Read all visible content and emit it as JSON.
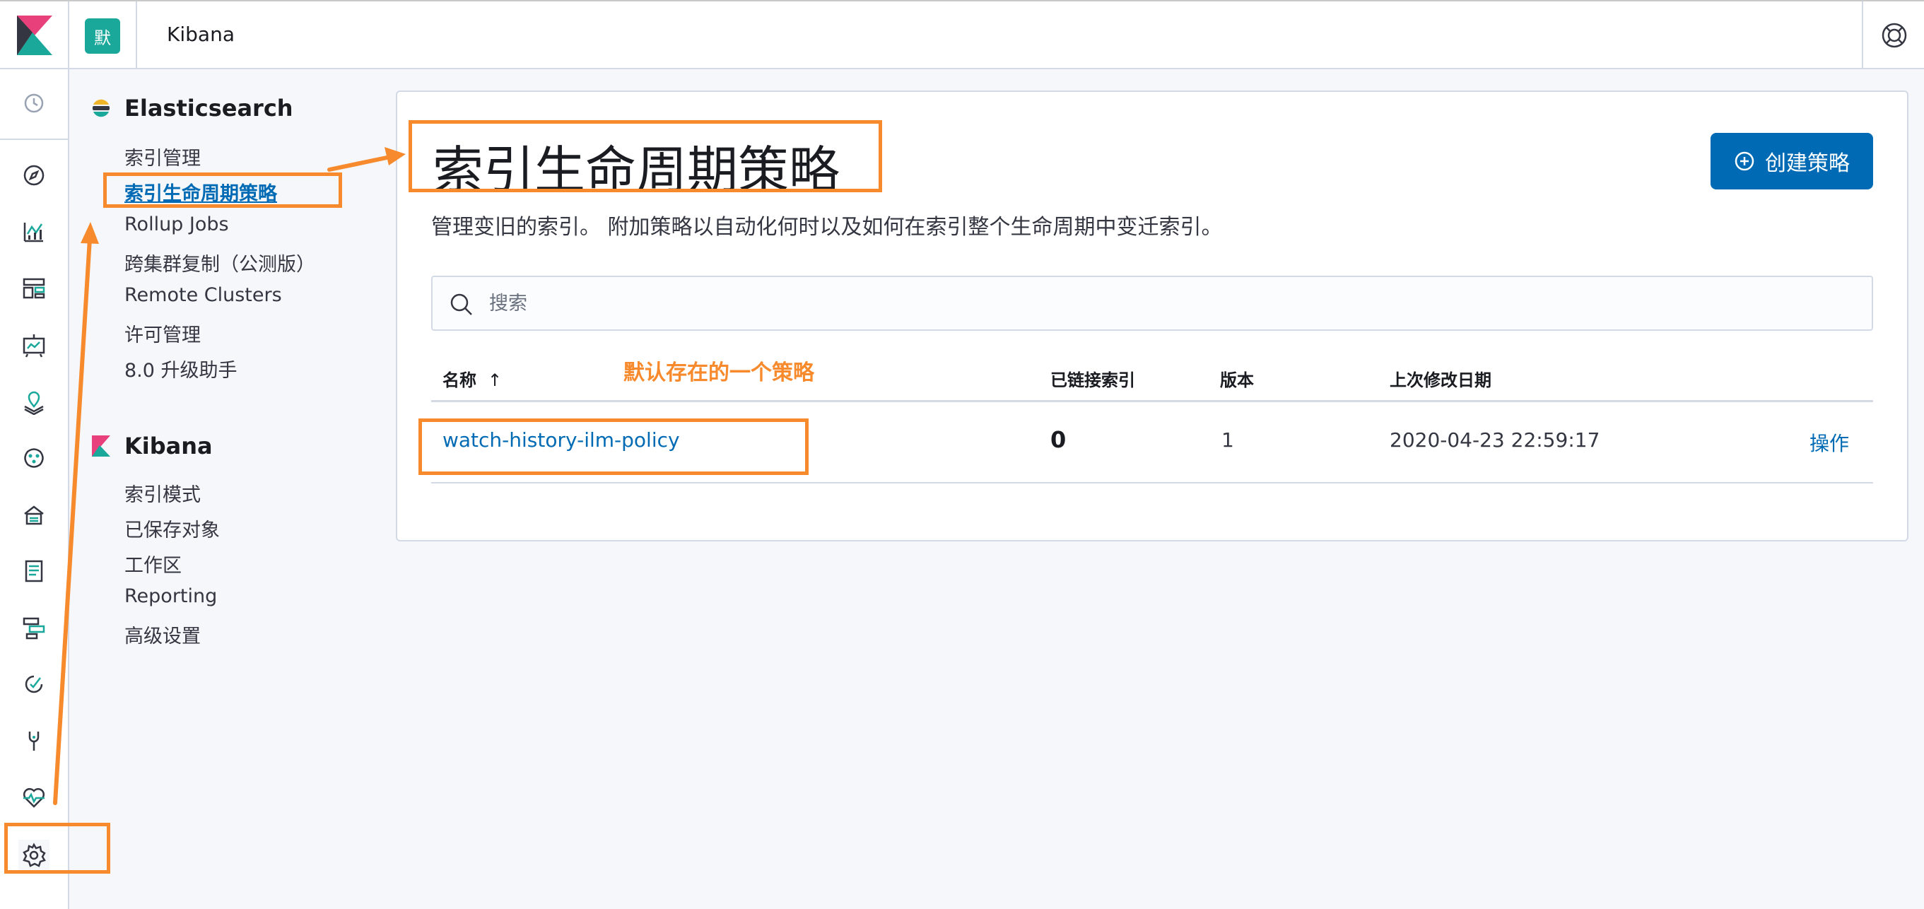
{
  "header": {
    "space_initial": "默",
    "brand": "Kibana"
  },
  "icon_nav": [
    {
      "name": "recent-icon"
    },
    {
      "name": "discover-icon"
    },
    {
      "name": "visualize-icon"
    },
    {
      "name": "dashboard-icon"
    },
    {
      "name": "canvas-icon"
    },
    {
      "name": "maps-icon"
    },
    {
      "name": "ml-icon"
    },
    {
      "name": "infrastructure-icon"
    },
    {
      "name": "logs-icon"
    },
    {
      "name": "apm-icon"
    },
    {
      "name": "uptime-icon"
    },
    {
      "name": "dev-tools-icon"
    },
    {
      "name": "monitoring-icon"
    },
    {
      "name": "management-icon"
    }
  ],
  "sidebar": {
    "elasticsearch": {
      "title": "Elasticsearch",
      "links": [
        "索引管理",
        "索引生命周期策略",
        "Rollup Jobs",
        "跨集群复制（公测版）",
        "Remote Clusters",
        "许可管理",
        "8.0 升级助手"
      ]
    },
    "kibana": {
      "title": "Kibana",
      "links": [
        "索引模式",
        "已保存对象",
        "工作区",
        "Reporting",
        "高级设置"
      ]
    }
  },
  "main": {
    "title": "索引生命周期策略",
    "create_button": "创建策略",
    "description": "管理变旧的索引。 附加策略以自动化何时以及如何在索引整个生命周期中变迁索引。",
    "search_placeholder": "搜索",
    "table": {
      "columns": [
        "名称",
        "已链接索引",
        "版本",
        "上次修改日期"
      ],
      "rows": [
        {
          "name": "watch-history-ilm-policy",
          "linked_indices": "0",
          "version": "1",
          "modified": "2020-04-23 22:59:17",
          "action": "操作"
        }
      ]
    }
  },
  "annotations": {
    "note": "默认存在的一个策略",
    "color": "#f78a2c"
  },
  "colors": {
    "accent": "#006bb4",
    "kibana_teal": "#1aa89b",
    "annotation": "#f78a2c"
  }
}
